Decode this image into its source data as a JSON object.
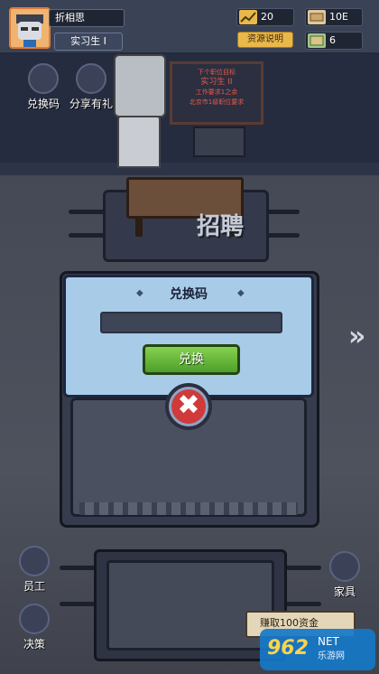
{
  "player": {
    "name": "折相思",
    "title": "实习生 I"
  },
  "resources": [
    {
      "icon": "growth-icon",
      "value": "20"
    },
    {
      "icon": "money-icon",
      "value": "10E"
    },
    {
      "icon": "ticket-icon",
      "value": "6"
    }
  ],
  "explain_button": "资源说明",
  "side_buttons": {
    "redeem": "兑换码",
    "share": "分享有礼",
    "staff": "员工",
    "policy": "决策",
    "furniture": "家具"
  },
  "board": {
    "lines": [
      "下个职位目标",
      "实习生 II",
      "工作要求1之余",
      "北京市1级职位要求"
    ]
  },
  "room": {
    "recruit_label": "招聘"
  },
  "dialog": {
    "title": "兑换码",
    "input_value": "",
    "input_placeholder": "",
    "confirm_label": "兑换",
    "close_symbol": "✖"
  },
  "earn_bar": {
    "label": "赚取100资金"
  },
  "watermark": {
    "logo": "962",
    "site": "NET",
    "sub": "乐游网"
  },
  "colors": {
    "accent_green": "#5cb533",
    "close_red": "#d13a3a",
    "dialog_blue": "#a8cbe8"
  }
}
